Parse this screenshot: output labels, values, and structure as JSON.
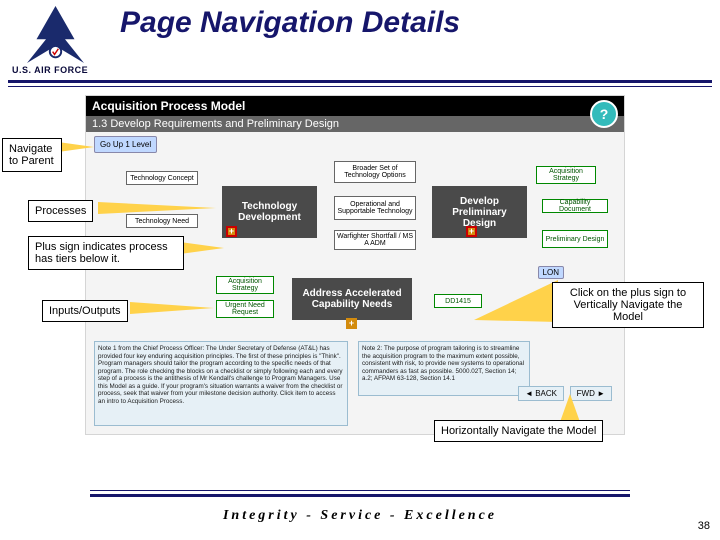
{
  "slide": {
    "title": "Page Navigation Details",
    "org": "U.S. AIR FORCE",
    "motto": "Integrity - Service - Excellence",
    "page_number": "38"
  },
  "model": {
    "header1": "Acquisition Process Model",
    "header2": "1.3 Develop Requirements and Preliminary Design",
    "goup": "Go Up 1 Level",
    "lon": "LON",
    "help": "?",
    "inputs": {
      "tech_concept": "Technology Concept",
      "tech_need": "Technology Need",
      "acq_strategy_l": "Acquisition Strategy",
      "urgent_need": "Urgent Need Request",
      "broader": "Broader Set of Technology Options",
      "operational": "Operational and Supportable Technology",
      "warfighter": "Warfighter Shortfall / MS A ADM",
      "acq_strategy_r": "Acquisition Strategy",
      "cap_doc": "Capability Document",
      "prelim_design": "Preliminary Design",
      "dd1415": "DD1415"
    },
    "processes": {
      "tech_dev": "Technology Development",
      "dev_prelim": "Develop Preliminary Design",
      "address_accel": "Address Accelerated Capability Needs"
    },
    "nav_back": "◄ BACK",
    "nav_fwd": "FWD ►",
    "note1": "Note 1 from the Chief Process Officer: The Under Secretary of Defense (AT&L) has provided four key enduring acquisition principles. The first of these principles is \"Think\". Program managers should tailor the program according to the specific needs of that program. The role checking the blocks on a checklist or simply following each and every step of a process is the antithesis of Mr Kendall's challenge to Program Managers. Use this Model as a guide. If your program's situation warrants a waiver from the checklist or process, seek that waiver from your milestone decision authority. Click item to access an intro to Acquisition Process.",
    "note2": "Note 2: The purpose of program tailoring is to streamline the acquisition program to the maximum extent possible, consistent with risk, to provide new systems to operational commanders as fast as possible. 5000.02T, Section 14; a.2; AFPAM 63-128, Section 14.1"
  },
  "callouts": {
    "nav_parent": "Navigate to Parent",
    "processes": "Processes",
    "plus_tiers": "Plus sign indicates process has tiers below it.",
    "io": "Inputs/Outputs",
    "click_plus": "Click on the plus sign to Vertically Navigate the Model",
    "horiz": "Horizontally Navigate the Model"
  }
}
